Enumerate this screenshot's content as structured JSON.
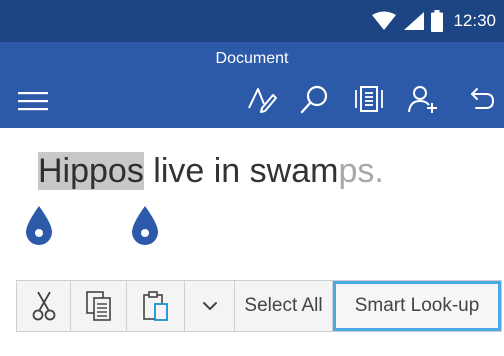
{
  "status_bar": {
    "time": "12:30",
    "icons": [
      "wifi-icon",
      "signal-icon",
      "battery-icon"
    ]
  },
  "app_bar": {
    "title": "Document",
    "icons": [
      "menu-icon",
      "draw-pen-icon",
      "search-icon",
      "reading-view-icon",
      "share-person-icon",
      "undo-icon"
    ]
  },
  "document": {
    "selected_text": "Hippos",
    "rest_text": " live in swam",
    "faded_text": "ps."
  },
  "context_menu": {
    "cut_icon": "scissors-icon",
    "copy_icon": "copy-icon",
    "paste_icon": "paste-icon",
    "more_icon": "chevron-down-icon",
    "select_all_label": "Select All",
    "smart_lookup_label": "Smart Look-up"
  },
  "colors": {
    "status_bar": "#1e4583",
    "app_bar": "#2c5aa9",
    "selection_handle": "#2c5aa9",
    "selection_highlight": "#c8c8c8",
    "focus_outline": "#4aa8e4"
  }
}
